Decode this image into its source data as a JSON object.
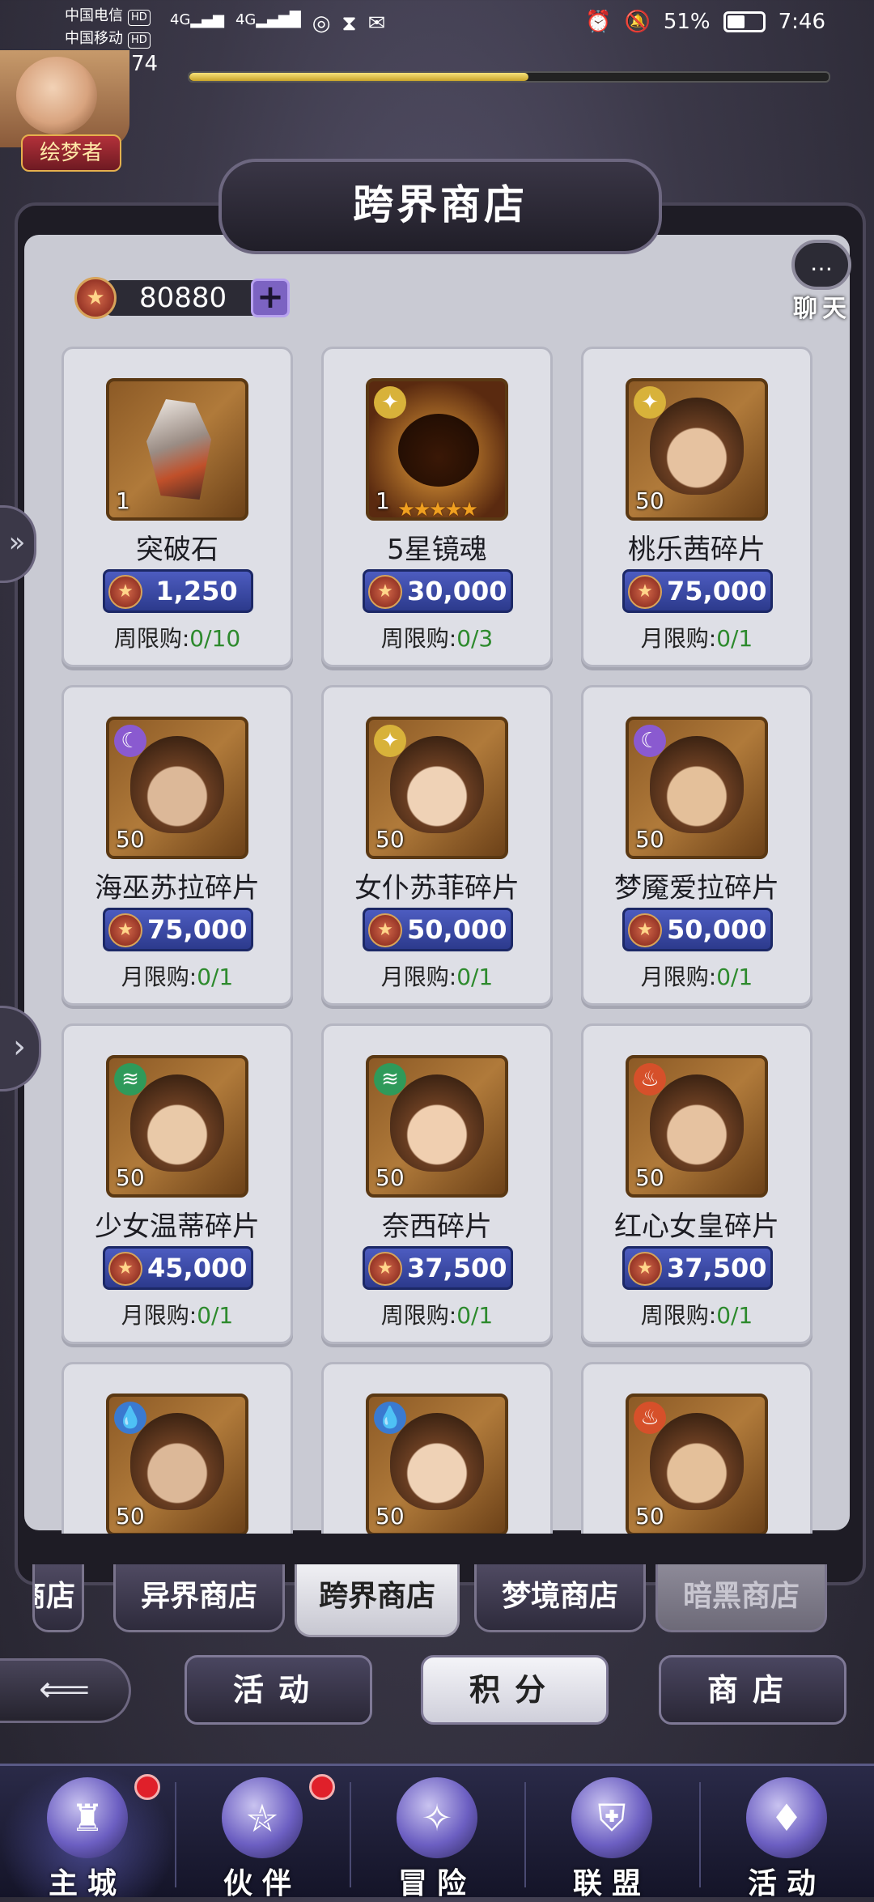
{
  "status_bar": {
    "carrier1": "中国电信",
    "carrier2": "中国移动",
    "hd": "HD",
    "signal_tag": "4G",
    "battery": "51%",
    "battery_level": 0.51,
    "time": "7:46"
  },
  "player": {
    "level": "74",
    "title": "绘梦者",
    "exp_progress": 0.53
  },
  "shop": {
    "title": "跨界商店",
    "currency_amount": "80880",
    "currency_plus": "+",
    "chat_label": "聊天",
    "chat_icon": "…"
  },
  "items": [
    {
      "name": "突破石",
      "qty": "1",
      "price": "1,250",
      "limit_label": "周限购:",
      "limit_value": "0/10",
      "icon": "stone",
      "element": null,
      "stars": ""
    },
    {
      "name": "5星镜魂",
      "qty": "1",
      "price": "30,000",
      "limit_label": "周限购:",
      "limit_value": "0/3",
      "icon": "mirror-soul",
      "element": "light",
      "stars": "★★★★★"
    },
    {
      "name": "桃乐茜碎片",
      "qty": "50",
      "price": "75,000",
      "limit_label": "月限购:",
      "limit_value": "0/1",
      "icon": "shard",
      "element": "light",
      "stars": ""
    },
    {
      "name": "海巫苏拉碎片",
      "qty": "50",
      "price": "75,000",
      "limit_label": "月限购:",
      "limit_value": "0/1",
      "icon": "shard",
      "element": "dark",
      "stars": ""
    },
    {
      "name": "女仆苏菲碎片",
      "qty": "50",
      "price": "50,000",
      "limit_label": "月限购:",
      "limit_value": "0/1",
      "icon": "shard",
      "element": "light",
      "stars": ""
    },
    {
      "name": "梦魇爱拉碎片",
      "qty": "50",
      "price": "50,000",
      "limit_label": "月限购:",
      "limit_value": "0/1",
      "icon": "shard",
      "element": "dark",
      "stars": ""
    },
    {
      "name": "少女温蒂碎片",
      "qty": "50",
      "price": "45,000",
      "limit_label": "月限购:",
      "limit_value": "0/1",
      "icon": "shard",
      "element": "wind",
      "stars": ""
    },
    {
      "name": "奈西碎片",
      "qty": "50",
      "price": "37,500",
      "limit_label": "周限购:",
      "limit_value": "0/1",
      "icon": "shard",
      "element": "wind",
      "stars": ""
    },
    {
      "name": "红心女皇碎片",
      "qty": "50",
      "price": "37,500",
      "limit_label": "周限购:",
      "limit_value": "0/1",
      "icon": "shard",
      "element": "fire",
      "stars": ""
    },
    {
      "name": "",
      "qty": "50",
      "price": "",
      "limit_label": "",
      "limit_value": "",
      "icon": "shard",
      "element": "water",
      "stars": ""
    },
    {
      "name": "",
      "qty": "50",
      "price": "",
      "limit_label": "",
      "limit_value": "",
      "icon": "shard",
      "element": "water",
      "stars": ""
    },
    {
      "name": "",
      "qty": "50",
      "price": "",
      "limit_label": "",
      "limit_value": "",
      "icon": "shard",
      "element": "fire",
      "stars": ""
    }
  ],
  "store_tabs": [
    {
      "label": "商店",
      "state": "partial"
    },
    {
      "label": "异界商店",
      "state": "normal"
    },
    {
      "label": "跨界商店",
      "state": "active"
    },
    {
      "label": "梦境商店",
      "state": "normal"
    },
    {
      "label": "暗黑商店",
      "state": "disabled"
    }
  ],
  "categories": [
    {
      "label": "活动",
      "active": false
    },
    {
      "label": "积分",
      "active": true
    },
    {
      "label": "商店",
      "active": false
    }
  ],
  "bottom_nav": [
    {
      "label": "主城",
      "icon": "castle-icon",
      "badge": true,
      "active": true
    },
    {
      "label": "伙伴",
      "icon": "witch-hat-icon",
      "badge": true,
      "active": false
    },
    {
      "label": "冒险",
      "icon": "compass-icon",
      "badge": false,
      "active": false
    },
    {
      "label": "联盟",
      "icon": "shield-icon",
      "badge": false,
      "active": false
    },
    {
      "label": "活动",
      "icon": "cards-icon",
      "badge": false,
      "active": false
    }
  ],
  "colors": {
    "price_bg": "#3a48a8",
    "limit_value": "#2d8a2d",
    "badge_red": "#e0202a",
    "element_light": "#d8b23a",
    "element_dark": "#8a5ad0",
    "element_wind": "#2f9a5a",
    "element_fire": "#d6502a",
    "element_water": "#3a7ad0"
  }
}
